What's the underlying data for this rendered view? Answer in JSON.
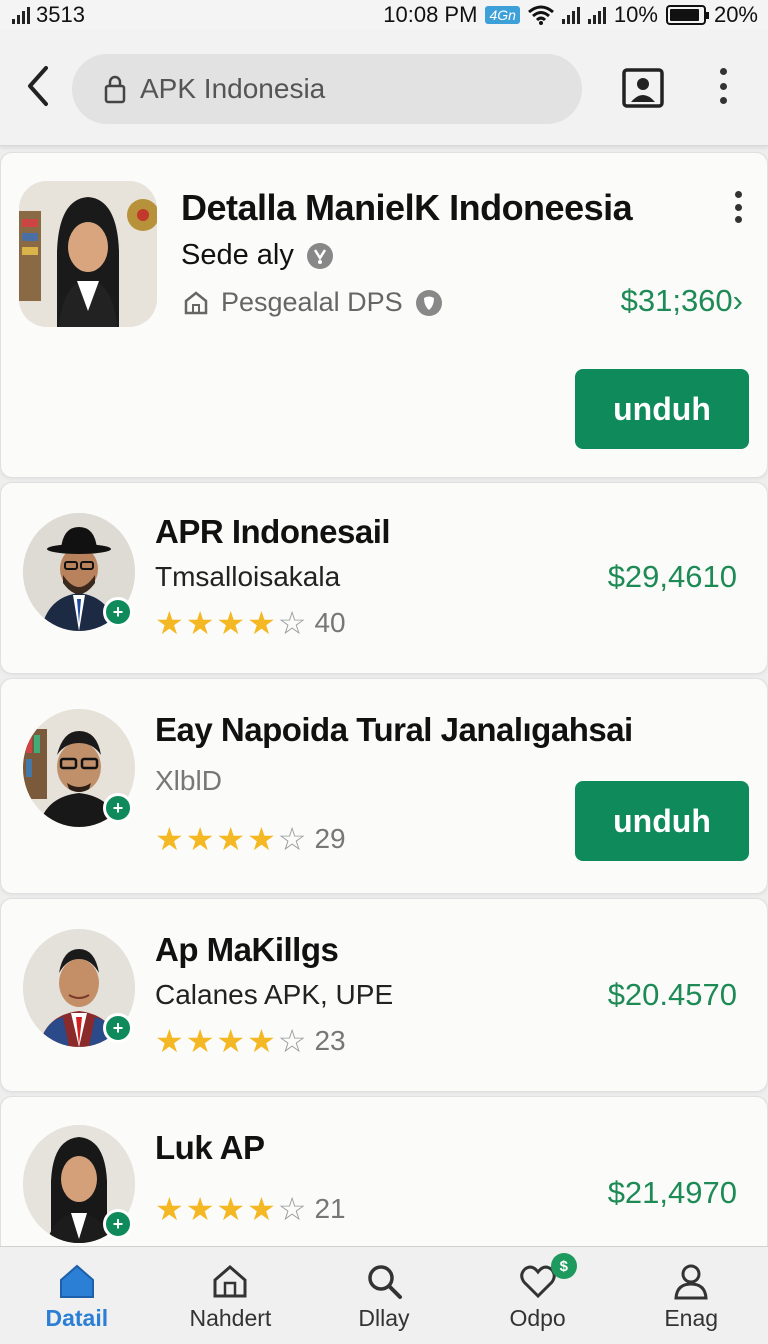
{
  "status_bar": {
    "carrier": "3513",
    "time": "10:08 PM",
    "network_badge": "4Gn",
    "battery_percent": "10%",
    "battery_level": 0.9,
    "extra_percent": "20%"
  },
  "search": {
    "placeholder": "APK Indonesia"
  },
  "featured": {
    "title": "Detalla ManielK Indoneesia",
    "subtitle": "Sede aly",
    "meta": "Pesgealal DPS",
    "price": "$31;360",
    "price_suffix": "›",
    "download_label": "unduh"
  },
  "apps": [
    {
      "name": "APR Indonesail",
      "subtitle": "Tmsalloisakala",
      "rating": 4,
      "rating_count": "40",
      "price": "$29,4610",
      "download_label": ""
    },
    {
      "name": "Eay Napoida Tural Janalıgahsai",
      "subtitle": "XlblD",
      "rating": 4,
      "rating_count": "29",
      "price": "",
      "download_label": "unduh"
    },
    {
      "name": "Ap MaKillgs",
      "subtitle": "Calanes APK, UPE",
      "rating": 4,
      "rating_count": "23",
      "price": "$20.4570",
      "download_label": ""
    },
    {
      "name": "Luk AP",
      "subtitle": "",
      "rating": 4,
      "rating_count": "21",
      "price": "$21,4970",
      "download_label": ""
    }
  ],
  "bottom_nav": [
    {
      "label": "Datail",
      "icon": "home-filled-icon",
      "active": true
    },
    {
      "label": "Nahdert",
      "icon": "home-outline-icon",
      "active": false
    },
    {
      "label": "Dllay",
      "icon": "search-icon",
      "active": false
    },
    {
      "label": "Odpo",
      "icon": "heart-icon",
      "active": false,
      "badge": "$"
    },
    {
      "label": "Enag",
      "icon": "person-icon",
      "active": false
    }
  ],
  "colors": {
    "accent_green": "#0f8a5a",
    "price_green": "#1e8a55",
    "star_gold": "#f3b823",
    "nav_active_blue": "#2b7fd4"
  }
}
